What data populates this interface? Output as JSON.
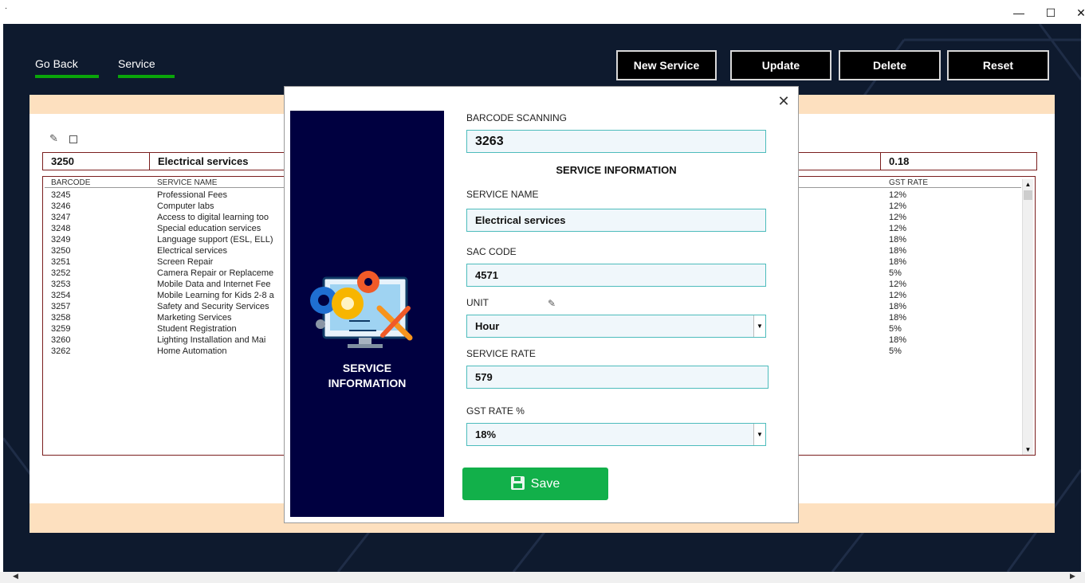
{
  "window": {
    "title_mark": ".",
    "minimize_icon": "minimize-icon",
    "maximize_icon": "maximize-icon",
    "close_icon": "close-icon"
  },
  "nav": {
    "go_back": "Go Back",
    "service": "Service"
  },
  "toolbar": {
    "new_service": "New Service",
    "update": "Update",
    "delete": "Delete",
    "reset": "Reset"
  },
  "selected_row": {
    "barcode": "3250",
    "service_name": "Electrical services",
    "gst_rate": "0.18"
  },
  "table": {
    "headers": {
      "barcode": "BARCODE",
      "service_name": "SERVICE NAME",
      "gst_rate": "GST RATE"
    },
    "rows": [
      {
        "barcode": "3245",
        "service_name": "Professional Fees",
        "gst": "12%"
      },
      {
        "barcode": "3246",
        "service_name": "Computer labs",
        "gst": "12%"
      },
      {
        "barcode": "3247",
        "service_name": "Access to digital learning too",
        "gst": "12%"
      },
      {
        "barcode": "3248",
        "service_name": "Special education services",
        "gst": "12%"
      },
      {
        "barcode": "3249",
        "service_name": "Language support (ESL, ELL)",
        "gst": "18%"
      },
      {
        "barcode": "3250",
        "service_name": "Electrical services",
        "gst": "18%"
      },
      {
        "barcode": "3251",
        "service_name": "Screen Repair",
        "gst": "18%"
      },
      {
        "barcode": "3252",
        "service_name": "Camera Repair or Replaceme",
        "gst": "5%"
      },
      {
        "barcode": "3253",
        "service_name": "Mobile Data and Internet Fee",
        "gst": "12%"
      },
      {
        "barcode": "3254",
        "service_name": "Mobile Learning for Kids 2-8 a",
        "gst": "12%"
      },
      {
        "barcode": "3257",
        "service_name": "Safety and Security Services",
        "gst": "18%"
      },
      {
        "barcode": "3258",
        "service_name": "Marketing Services",
        "gst": "18%"
      },
      {
        "barcode": "3259",
        "service_name": "Student Registration",
        "gst": "5%"
      },
      {
        "barcode": "3260",
        "service_name": "Lighting Installation and Mai",
        "gst": "18%"
      },
      {
        "barcode": "3262",
        "service_name": "Home Automation",
        "gst": "5%"
      }
    ]
  },
  "modal": {
    "sidebar_title_line1": "SERVICE",
    "sidebar_title_line2": "INFORMATION",
    "barcode_label": "BARCODE SCANNING",
    "barcode_value": "3263",
    "section_title": "SERVICE INFORMATION",
    "service_name_label": "SERVICE NAME",
    "service_name_value": "Electrical services",
    "sac_label": "SAC CODE",
    "sac_value": "4571",
    "unit_label": "UNIT",
    "unit_value": "Hour",
    "rate_label": "SERVICE RATE",
    "rate_value": "579",
    "gst_label": "GST RATE %",
    "gst_value": "18%",
    "save_label": "Save"
  },
  "colors": {
    "background": "#0e1a2e",
    "accent_green": "#12b04a",
    "nav_underline": "#0aa60a",
    "band": "#fde0bf",
    "sidebar": "#000040"
  }
}
